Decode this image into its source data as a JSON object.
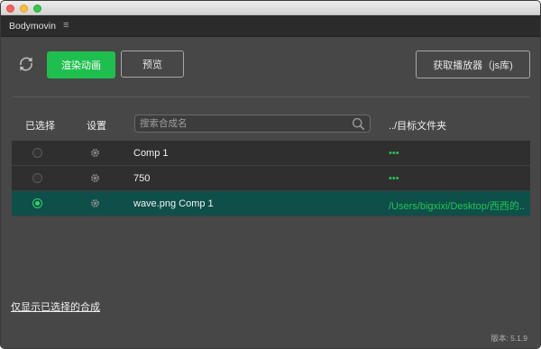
{
  "panel": {
    "tab_label": "Bodymovin",
    "menu_glyph": "≡"
  },
  "toolbar": {
    "render_label": "渲染动画",
    "preview_label": "预览",
    "get_player_label": "获取播放器（js库)"
  },
  "columns": {
    "selected": "已选择",
    "settings": "设置",
    "destination": "../目标文件夹"
  },
  "search": {
    "placeholder": "搜索合成名",
    "value": ""
  },
  "compositions": [
    {
      "name": "Comp 1",
      "destination": "•••",
      "selected": false
    },
    {
      "name": "750",
      "destination": "•••",
      "selected": false
    },
    {
      "name": "wave.png Comp 1",
      "destination": "/Users/bigxixi/Desktop/西西的...",
      "selected": true
    }
  ],
  "footer": {
    "filter_link": "仅显示已选择的合成",
    "version": "版本: 5.1.9"
  },
  "colors": {
    "accent": "#1fbf4f",
    "selected_row": "#0e4f4a",
    "background": "#474747"
  }
}
